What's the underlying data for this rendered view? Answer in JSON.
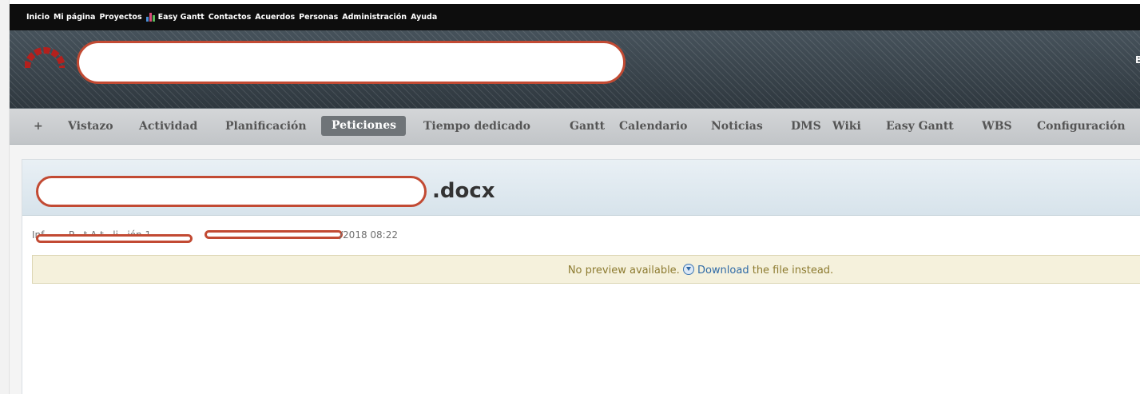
{
  "top_menu": {
    "items": [
      "Inicio",
      "Mi página",
      "Proyectos",
      "Easy Gantt",
      "Contactos",
      "Acuerdos",
      "Personas",
      "Administración",
      "Ayuda"
    ]
  },
  "header": {
    "search_value": "",
    "cut_text": "B"
  },
  "main_menu": {
    "items": [
      "+",
      "Vistazo",
      "Actividad",
      "Planificación",
      "Peticiones",
      "Tiempo dedicado",
      "Gantt",
      "Calendario",
      "Noticias",
      "DMS",
      "Wiki",
      "Easy Gantt",
      "WBS",
      "Configuración"
    ],
    "selected": "Peticiones"
  },
  "file": {
    "title": ".docx",
    "meta_visible": "Inf        P   t A t   li   ión 1 - ",
    "date": "/2018 08:22"
  },
  "preview": {
    "prefix": "No preview available.",
    "link": "Download",
    "suffix": "the file instead."
  },
  "colors": {
    "redaction": "#c24a33",
    "top_menu_bg": "#0d0d0d",
    "header_bg": "#3b454d",
    "selected_tab_bg": "#6f7478",
    "flash_bg": "#f5f1dc",
    "link": "#2f6aa6"
  },
  "icons": [
    "redmine-logo-icon",
    "easy-gantt-icon",
    "download-icon"
  ]
}
